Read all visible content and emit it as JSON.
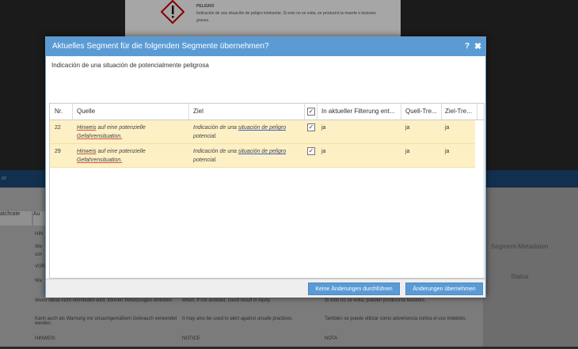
{
  "background": {
    "doc_text": "Indicación de una situación de peligro inminente. Si esto no se evita, se producirá la muerte o lesiones graves.",
    "doc_heading": "PELIGRO",
    "band_label": "or",
    "grid_header": "atchrate",
    "grid_header2": "Au",
    "rows": [
      {
        "a": "HIN",
        "b": "",
        "c": ""
      },
      {
        "a": "We",
        "b": "",
        "c": ""
      },
      {
        "a": "sch",
        "b": "",
        "c": ""
      },
      {
        "a": "VOR",
        "b": "",
        "c": ""
      },
      {
        "a": "Wa",
        "b": "",
        "c": ""
      },
      {
        "a": "Wenn diese nicht vermieden wird, können Verletzungen eintreten.",
        "b": "which, if not avoided, could result in injury.",
        "c": "Si esto no se evita, pueden producirse lesiones."
      },
      {
        "a": "Kann auch als Warnung vor unsachgemäßem Gebrauch verwendet werden.",
        "b": "It may also be used to alert against unsafe practices.",
        "c": "También se puede utilizar como advertencia contra el uso indebido."
      },
      {
        "a": "HINWEIS",
        "b": "NOTICE",
        "c": "NOTA"
      }
    ],
    "right_panel": {
      "title": "Segment-Metadaten",
      "status": "Status"
    }
  },
  "dialog": {
    "title": "Aktuelles Segment für die folgenden Segmente übernehmen?",
    "help": "?",
    "close": "✖",
    "source_text": "Indicación de una situación de potencialmente peligrosa",
    "columns": [
      "Nr.",
      "Quelle",
      "Ziel",
      "",
      "In aktueller Filterung ent...",
      "Quell-Tre...",
      "Ziel-Tre..."
    ],
    "rows": [
      {
        "nr": "22",
        "quelle_1": "Hinweis",
        "quelle_2": " auf eine potenzielle",
        "quelle_3": "Gefahrensituation.",
        "ziel_1": "Indicación de una ",
        "ziel_2": "situación de peligro",
        "ziel_3": "potencial.",
        "checked": true,
        "filter": "ja",
        "quell": "ja",
        "ziel": "ja"
      },
      {
        "nr": "29",
        "quelle_1": "Hinweis",
        "quelle_2": " auf eine potenzielle",
        "quelle_3": "Gefahrensituation.",
        "ziel_1": "Indicación de una ",
        "ziel_2": "situación de peligro",
        "ziel_3": "potencial.",
        "checked": true,
        "filter": "ja",
        "quell": "ja",
        "ziel": "ja"
      }
    ],
    "buttons": {
      "cancel": "Keine Änderungen durchführen",
      "apply": "Änderungen übernehmen"
    }
  },
  "colors": {
    "header": "#5a9bd5",
    "row_highlight": "#fcf0c4"
  }
}
